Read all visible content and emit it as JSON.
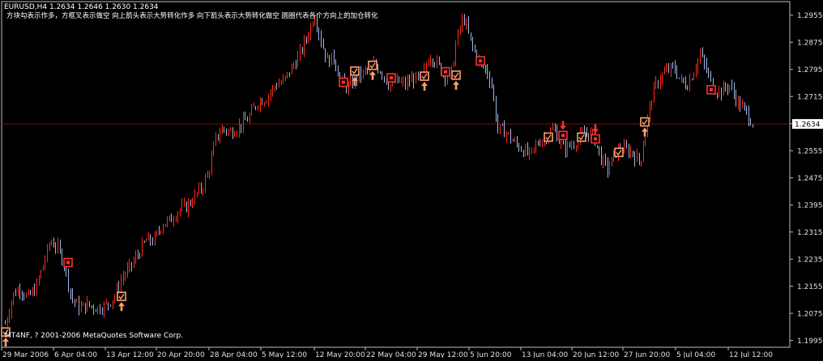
{
  "window": {
    "symbol_line": "EURUSD,H4  1.2634 1.2646 1.2630 1.2634",
    "legend_text": "方块勾表示作多，方框叉表示做空 向上箭头表示大势转化作多 向下箭头表示大势转化做空 圆圈代表各个方向上的加仓转化",
    "copyright": "MT4NF, ? 2001-2006 MetaQuotes Software Corp."
  },
  "colors": {
    "background": "#000000",
    "bull": "#ff2a1a",
    "bear": "#9fb8e8",
    "axis": "#c0c0c0",
    "price_line": "#7a1010",
    "marker_light": "#ffa070",
    "marker_dark": "#ff3030"
  },
  "chart_data": {
    "type": "candlestick",
    "symbol": "EURUSD",
    "timeframe": "H4",
    "current_price": "1.2634",
    "ylim": [
      1.1975,
      1.2995
    ],
    "yticks": [
      "1.2955",
      "1.2875",
      "1.2795",
      "1.2715",
      "1.2635",
      "1.2555",
      "1.2475",
      "1.2395",
      "1.2315",
      "1.2235",
      "1.2155",
      "1.2075",
      "1.1995"
    ],
    "xticks": [
      "29 Mar 2006",
      "6 Apr 04:00",
      "13 Apr 12:00",
      "20 Apr 20:00",
      "28 Apr 04:00",
      "5 May 12:00",
      "12 May 20:00",
      "22 May 04:00",
      "29 May 12:00",
      "5 Jun 20:00",
      "13 Jun 04:00",
      "20 Jun 12:00",
      "27 Jun 20:00",
      "5 Jul 04:00",
      "12 Jul 12:00"
    ],
    "price_path": [
      [
        0,
        1.2
      ],
      [
        8,
        1.206
      ],
      [
        16,
        1.213
      ],
      [
        24,
        1.215
      ],
      [
        34,
        1.212
      ],
      [
        44,
        1.215
      ],
      [
        52,
        1.221
      ],
      [
        62,
        1.229
      ],
      [
        70,
        1.227
      ],
      [
        78,
        1.223
      ],
      [
        88,
        1.212
      ],
      [
        98,
        1.209
      ],
      [
        108,
        1.21
      ],
      [
        120,
        1.209
      ],
      [
        132,
        1.21
      ],
      [
        142,
        1.213
      ],
      [
        150,
        1.218
      ],
      [
        160,
        1.221
      ],
      [
        170,
        1.225
      ],
      [
        180,
        1.229
      ],
      [
        190,
        1.229
      ],
      [
        200,
        1.234
      ],
      [
        210,
        1.235
      ],
      [
        220,
        1.238
      ],
      [
        230,
        1.239
      ],
      [
        240,
        1.242
      ],
      [
        250,
        1.245
      ],
      [
        258,
        1.25
      ],
      [
        266,
        1.259
      ],
      [
        274,
        1.262
      ],
      [
        284,
        1.261
      ],
      [
        296,
        1.263
      ],
      [
        306,
        1.265
      ],
      [
        318,
        1.27
      ],
      [
        328,
        1.271
      ],
      [
        340,
        1.275
      ],
      [
        350,
        1.276
      ],
      [
        360,
        1.28
      ],
      [
        370,
        1.284
      ],
      [
        380,
        1.29
      ],
      [
        388,
        1.296
      ],
      [
        396,
        1.288
      ],
      [
        404,
        1.282
      ],
      [
        412,
        1.283
      ],
      [
        420,
        1.276
      ],
      [
        430,
        1.274
      ],
      [
        440,
        1.277
      ],
      [
        452,
        1.279
      ],
      [
        462,
        1.281
      ],
      [
        470,
        1.279
      ],
      [
        480,
        1.275
      ],
      [
        490,
        1.276
      ],
      [
        500,
        1.275
      ],
      [
        510,
        1.277
      ],
      [
        520,
        1.276
      ],
      [
        530,
        1.284
      ],
      [
        540,
        1.281
      ],
      [
        548,
        1.278
      ],
      [
        556,
        1.277
      ],
      [
        564,
        1.289
      ],
      [
        572,
        1.295
      ],
      [
        580,
        1.288
      ],
      [
        590,
        1.282
      ],
      [
        598,
        1.28
      ],
      [
        606,
        1.276
      ],
      [
        614,
        1.262
      ],
      [
        624,
        1.261
      ],
      [
        634,
        1.258
      ],
      [
        644,
        1.256
      ],
      [
        654,
        1.254
      ],
      [
        664,
        1.258
      ],
      [
        674,
        1.26
      ],
      [
        684,
        1.262
      ],
      [
        694,
        1.256
      ],
      [
        704,
        1.257
      ],
      [
        714,
        1.259
      ],
      [
        722,
        1.261
      ],
      [
        732,
        1.26
      ],
      [
        742,
        1.253
      ],
      [
        750,
        1.25
      ],
      [
        760,
        1.255
      ],
      [
        770,
        1.256
      ],
      [
        780,
        1.255
      ],
      [
        790,
        1.252
      ],
      [
        798,
        1.264
      ],
      [
        806,
        1.273
      ],
      [
        814,
        1.277
      ],
      [
        822,
        1.279
      ],
      [
        832,
        1.28
      ],
      [
        840,
        1.276
      ],
      [
        848,
        1.275
      ],
      [
        856,
        1.279
      ],
      [
        864,
        1.284
      ],
      [
        872,
        1.279
      ],
      [
        880,
        1.274
      ],
      [
        890,
        1.273
      ],
      [
        900,
        1.275
      ],
      [
        910,
        1.27
      ],
      [
        920,
        1.267
      ],
      [
        930,
        1.2634
      ]
    ],
    "markers": [
      {
        "x": 7,
        "price": 1.202,
        "style": "light",
        "arrow": "up"
      },
      {
        "x": 84,
        "price": 1.2225,
        "style": "dark"
      },
      {
        "x": 150,
        "price": 1.2125,
        "style": "light",
        "arrow": "up"
      },
      {
        "x": 424,
        "price": 1.2757,
        "style": "dark"
      },
      {
        "x": 438,
        "price": 1.279,
        "style": "light",
        "arrow": "up"
      },
      {
        "x": 460,
        "price": 1.2807,
        "style": "light",
        "arrow": "up"
      },
      {
        "x": 483,
        "price": 1.277,
        "style": "dark"
      },
      {
        "x": 524,
        "price": 1.2775,
        "style": "light",
        "arrow": "up"
      },
      {
        "x": 550,
        "price": 1.2788,
        "style": "dark"
      },
      {
        "x": 563,
        "price": 1.2778,
        "style": "light",
        "arrow": "up"
      },
      {
        "x": 593,
        "price": 1.282,
        "style": "dark"
      },
      {
        "x": 677,
        "price": 1.2595,
        "style": "light"
      },
      {
        "x": 695,
        "price": 1.26,
        "style": "dark",
        "arrow": "down"
      },
      {
        "x": 718,
        "price": 1.2595,
        "style": "light"
      },
      {
        "x": 735,
        "price": 1.259,
        "style": "dark",
        "arrow": "down"
      },
      {
        "x": 764,
        "price": 1.255,
        "style": "light"
      },
      {
        "x": 796,
        "price": 1.264,
        "style": "light",
        "arrow": "up"
      },
      {
        "x": 878,
        "price": 1.2735,
        "style": "dark"
      }
    ]
  }
}
